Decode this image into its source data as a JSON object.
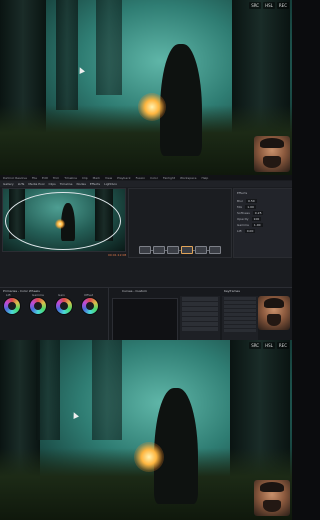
{
  "top_frame": {
    "tags": [
      "SRC",
      "HSL",
      "REC"
    ]
  },
  "resolve": {
    "menu": [
      "DaVinci Resolve",
      "File",
      "Edit",
      "Trim",
      "Timeline",
      "Clip",
      "Mark",
      "View",
      "Playback",
      "Fusion",
      "Color",
      "Fairlight",
      "Workspace",
      "Help"
    ],
    "toolbar": [
      "Gallery",
      "LUTs",
      "Media Pool",
      "Clips",
      "Timeline",
      "Nodes",
      "Effects",
      "Lightbox"
    ],
    "clip_label": "Forest_01",
    "timecode": "00:01:12:08",
    "inspector": {
      "title": "Effects",
      "rows": [
        {
          "label": "Blur",
          "value": "0.50"
        },
        {
          "label": "Mix",
          "value": "1.00"
        },
        {
          "label": "Softness",
          "value": "0.25"
        },
        {
          "label": "Opacity",
          "value": "100"
        },
        {
          "label": "Gamma",
          "value": "1.00"
        },
        {
          "label": "Lift",
          "value": "0.00"
        }
      ]
    },
    "wheels": [
      "Lift",
      "Gamma",
      "Gain",
      "Offset"
    ],
    "deck_titles": [
      "Primaries - Color Wheels",
      "Curves - Custom",
      "Keyframes"
    ]
  },
  "bottom_frame": {
    "tags": [
      "SRC",
      "HSL",
      "REC"
    ]
  }
}
